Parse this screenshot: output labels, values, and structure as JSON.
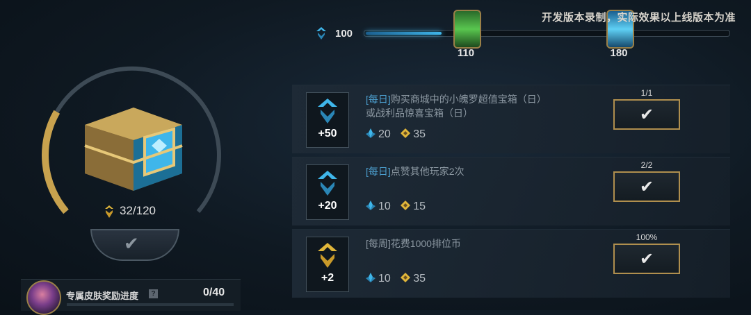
{
  "watermark": "开发版本录制，实际效果以上线版本为准",
  "track": {
    "current_value": "100",
    "progress_fraction": 0.21,
    "milestones": [
      {
        "label": "110",
        "color": "#49b24a"
      },
      {
        "label": "180",
        "color": "#3fb6ea"
      }
    ]
  },
  "chest": {
    "score": "32/120",
    "ring_progress_fraction": 0.27
  },
  "claim_button": {
    "icon": "checkmark-icon"
  },
  "skin_reward": {
    "label": "专属皮肤奖励进度",
    "help_icon": "?",
    "count": "0/40"
  },
  "tasks": [
    {
      "points": "+50",
      "icon_color": "#3fb6ea",
      "tag": "[每日]",
      "title_line1": "购买商城中的小魄罗超值宝箱（日）",
      "title_line2": "或战利品惊喜宝箱（日）",
      "reward_blue": "20",
      "reward_gold": "35",
      "progress": "1/1"
    },
    {
      "points": "+20",
      "icon_color": "#3fb6ea",
      "tag": "[每日]",
      "title_line1": "点赞其他玩家2次",
      "title_line2": "",
      "reward_blue": "10",
      "reward_gold": "15",
      "progress": "2/2"
    },
    {
      "points": "+2",
      "icon_color": "#e0b63a",
      "tag": "[每周]",
      "title_line1": "花费1000排位币",
      "title_line2": "",
      "reward_blue": "10",
      "reward_gold": "35",
      "progress": "100%"
    }
  ],
  "colors": {
    "accent_gold": "#b08f4e",
    "accent_blue": "#3fb6ea"
  }
}
